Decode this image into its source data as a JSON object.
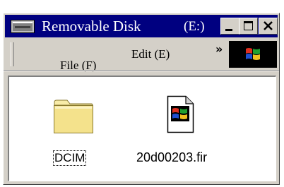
{
  "window": {
    "title": "Removable Disk",
    "drive": "(E:)"
  },
  "menu": {
    "items": [
      {
        "label": "File (F)"
      },
      {
        "label": "Edit (E)"
      }
    ],
    "more": "»"
  },
  "files": [
    {
      "name": "DCIM",
      "type": "folder",
      "selected_focus": true
    },
    {
      "name": "20d00203.fir",
      "type": "file",
      "icon": "windows-document-icon"
    }
  ],
  "colors": {
    "titlebar": "#000080",
    "chrome": "#d4d0c8",
    "folder": "#f4e28c"
  }
}
